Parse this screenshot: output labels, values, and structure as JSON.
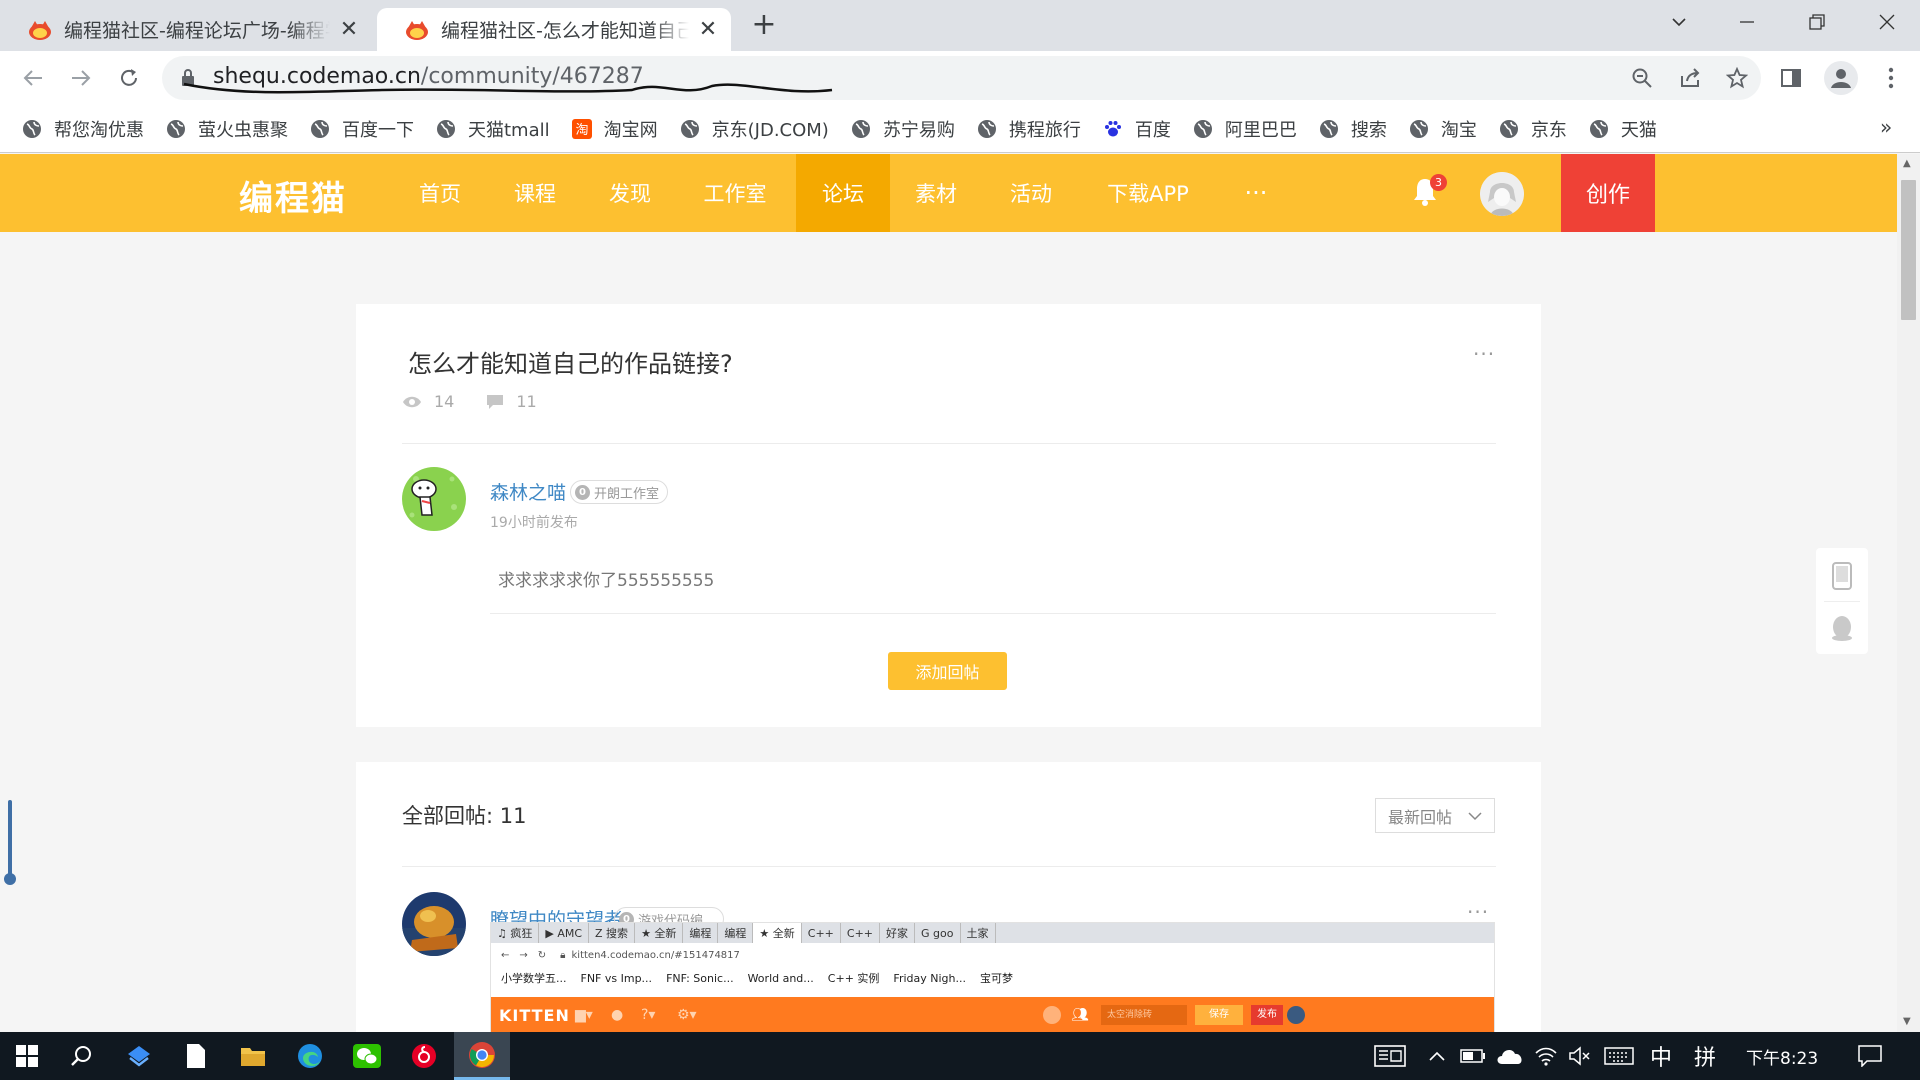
{
  "browser": {
    "tabs": [
      {
        "title": "编程猫社区-编程论坛广场-编程学",
        "active": false
      },
      {
        "title": "编程猫社区-怎么才能知道自己的",
        "active": true
      }
    ],
    "url_host": "shequ.codemao.cn",
    "url_path": "/community/467287",
    "bookmarks": [
      "帮您淘优惠",
      "萤火虫惠聚",
      "百度一下",
      "天猫tmall",
      "淘宝网",
      "京东(JD.COM)",
      "苏宁易购",
      "携程旅行",
      "百度",
      "阿里巴巴",
      "搜索",
      "淘宝",
      "京东",
      "天猫"
    ],
    "bookmarks_overflow": "»"
  },
  "site": {
    "logo": "编程猫",
    "nav": [
      "首页",
      "课程",
      "发现",
      "工作室",
      "论坛",
      "素材",
      "活动",
      "下载APP"
    ],
    "active_nav": "论坛",
    "more": "···",
    "notification_count": "3",
    "create_label": "创作",
    "accent": "#fdc030",
    "create_color": "#ef4136"
  },
  "post": {
    "title": "怎么才能知道自己的作品链接?",
    "views": "14",
    "comments": "11",
    "author": "森林之喵",
    "author_badge_level": "0",
    "author_badge": "开朗工作室",
    "time": "19小时前发布",
    "body": "求求求求求你了555555555",
    "reply_button": "添加回帖",
    "menu": "···"
  },
  "replies": {
    "header": "全部回帖: 11",
    "sort": "最新回帖",
    "first": {
      "author": "瞭望中的守望者",
      "badge_level": "0",
      "badge": "游戏代码编...",
      "menu": "···",
      "screenshot": {
        "tabs": [
          "♫ 疯狂",
          "▶ AMC",
          "Z 搜索",
          "★ 全新",
          "编程",
          "编程",
          "★ 全新",
          "C++",
          "C++",
          "好家",
          "G goo",
          "土家"
        ],
        "url": "kitten4.codemao.cn/#151474817",
        "bookmarks": [
          "小学数学五...",
          "FNF vs Imp...",
          "FNF: Sonic...",
          "World and...",
          "C++ 实例",
          "Friday Nigh...",
          "宝可梦"
        ],
        "app_name": "KITTEN",
        "save": "保存",
        "publish": "发布",
        "input_placeholder": "太空消除砖"
      }
    }
  },
  "taskbar": {
    "ime_lang": "中",
    "ime_mode": "拼",
    "clock": "下午8:23"
  }
}
